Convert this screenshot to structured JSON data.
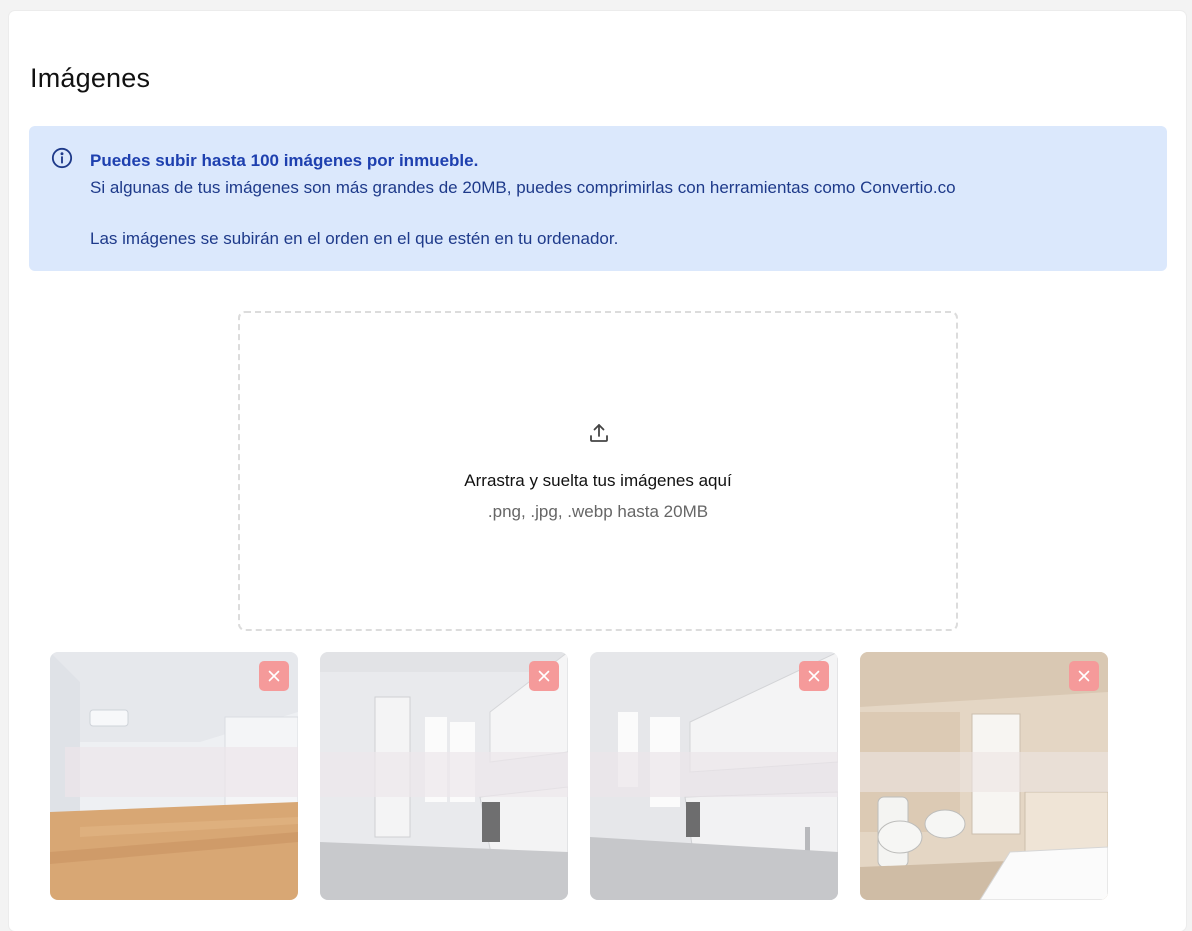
{
  "section": {
    "title": "Imágenes"
  },
  "info": {
    "icon": "info-icon",
    "heading": "Puedes subir hasta 100 imágenes por inmueble.",
    "line1": "Si algunas de tus imágenes son más grandes de 20MB, puedes comprimirlas con herramientas como Convertio.co",
    "line2": "Las imágenes se subirán en el orden en el que estén en tu ordenador.",
    "bg_color": "#dbe8fc",
    "text_color": "#1e3a8a"
  },
  "dropzone": {
    "icon": "upload-icon",
    "title": "Arrastra y suelta tus imágenes aquí",
    "subtitle": ".png, .jpg, .webp hasta 20MB"
  },
  "images": [
    {
      "scene": "living-room",
      "remove_icon": "close-icon"
    },
    {
      "scene": "kitchen",
      "remove_icon": "close-icon"
    },
    {
      "scene": "kitchen",
      "remove_icon": "close-icon"
    },
    {
      "scene": "bathroom",
      "remove_icon": "close-icon"
    }
  ],
  "colors": {
    "remove_button": "#f59a9a"
  }
}
